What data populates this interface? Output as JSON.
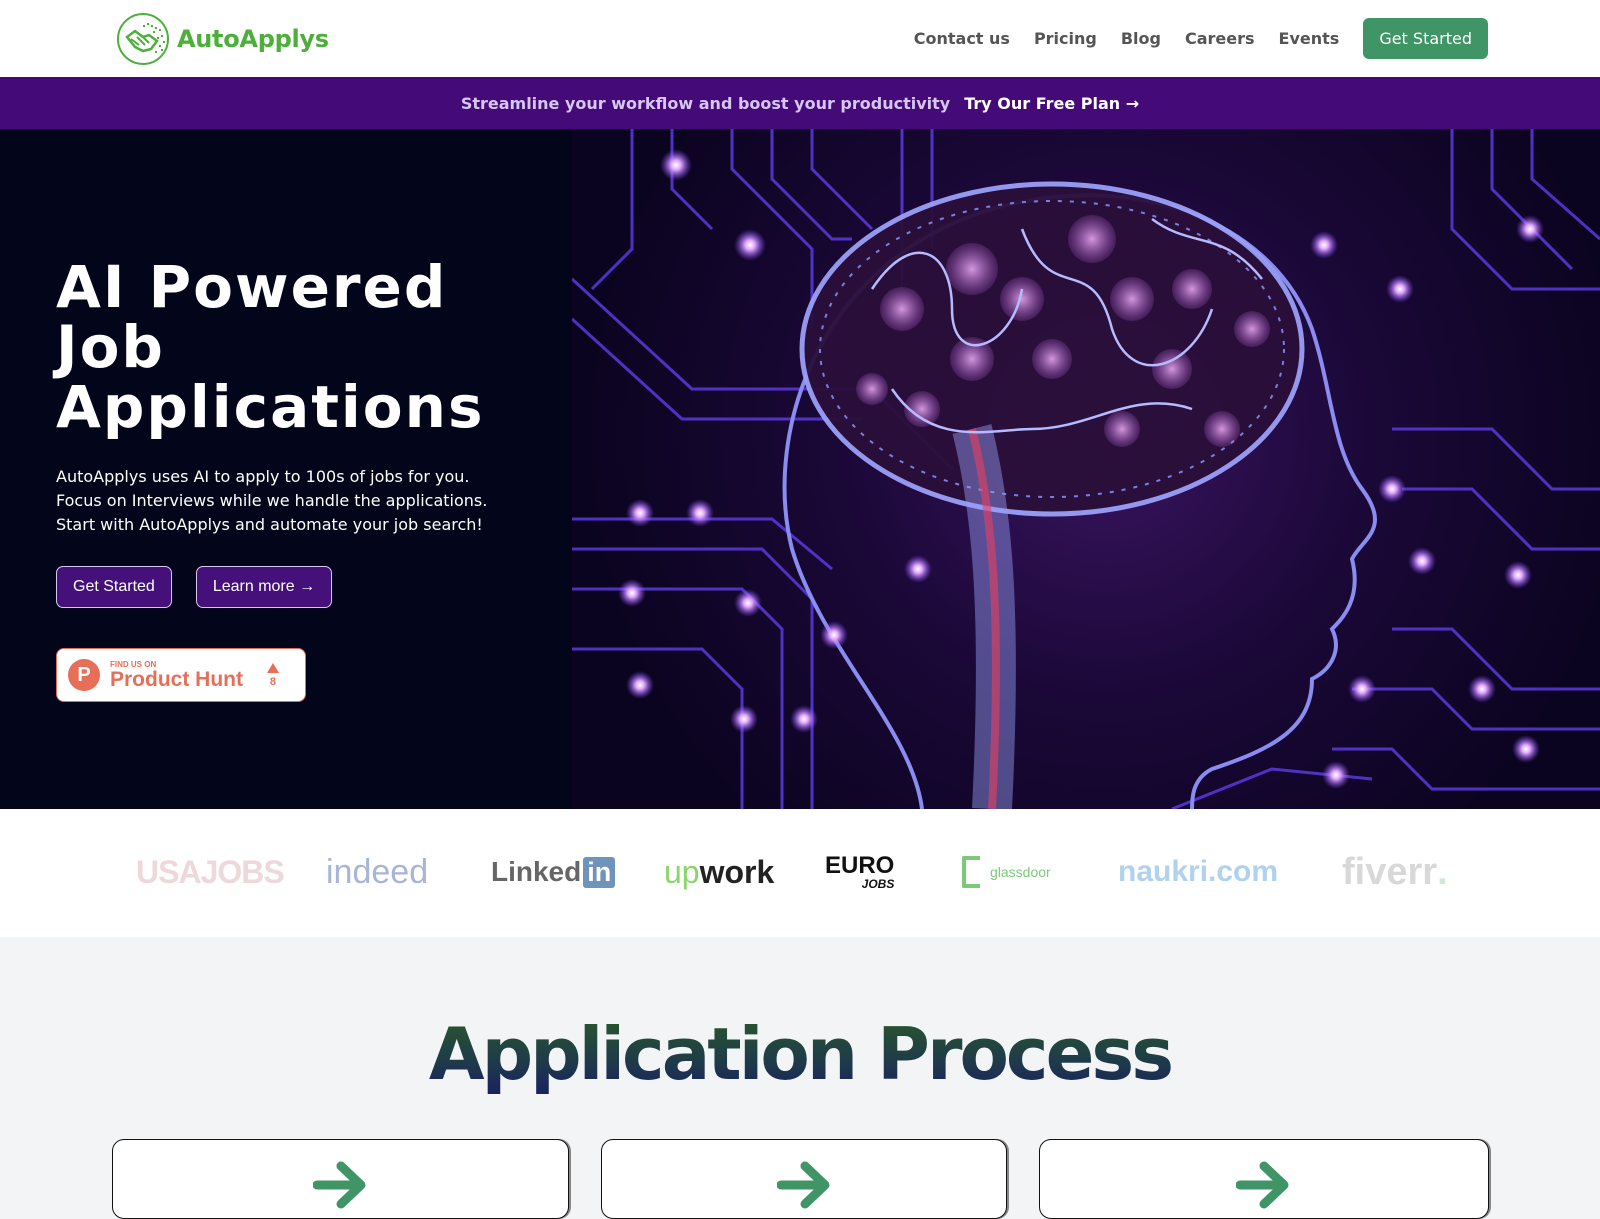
{
  "header": {
    "brand": "AutoApplys",
    "nav": [
      "Contact us",
      "Pricing",
      "Blog",
      "Careers",
      "Events"
    ],
    "cta": "Get Started"
  },
  "banner": {
    "text": "Streamline your workflow and boost your productivity",
    "link": "Try Our Free Plan →"
  },
  "hero": {
    "title_lines": [
      "AI Powered",
      "Job",
      "Applications"
    ],
    "description": "AutoApplys uses AI to apply to 100s of jobs for you. Focus on Interviews while we handle the applications. Start with AutoApplys and automate your job search!",
    "primary_button": "Get Started",
    "secondary_button": "Learn more →",
    "product_hunt": {
      "small": "FIND US ON",
      "big": "Product Hunt",
      "letter": "P",
      "votes": "8"
    }
  },
  "partners": [
    "USAJOBS",
    "indeed",
    "Linked",
    "in",
    "up",
    "work",
    "EURO",
    "JOBS",
    "glassdoor",
    "naukri",
    ".com",
    "fiverr",
    "."
  ],
  "process": {
    "title": "Application Process",
    "cards": 3
  },
  "colors": {
    "brand_green": "#4caf3a",
    "cta_green": "#3f9566",
    "banner_purple": "#430a78",
    "hero_bg": "#03061a",
    "product_hunt": "#e76f58"
  }
}
